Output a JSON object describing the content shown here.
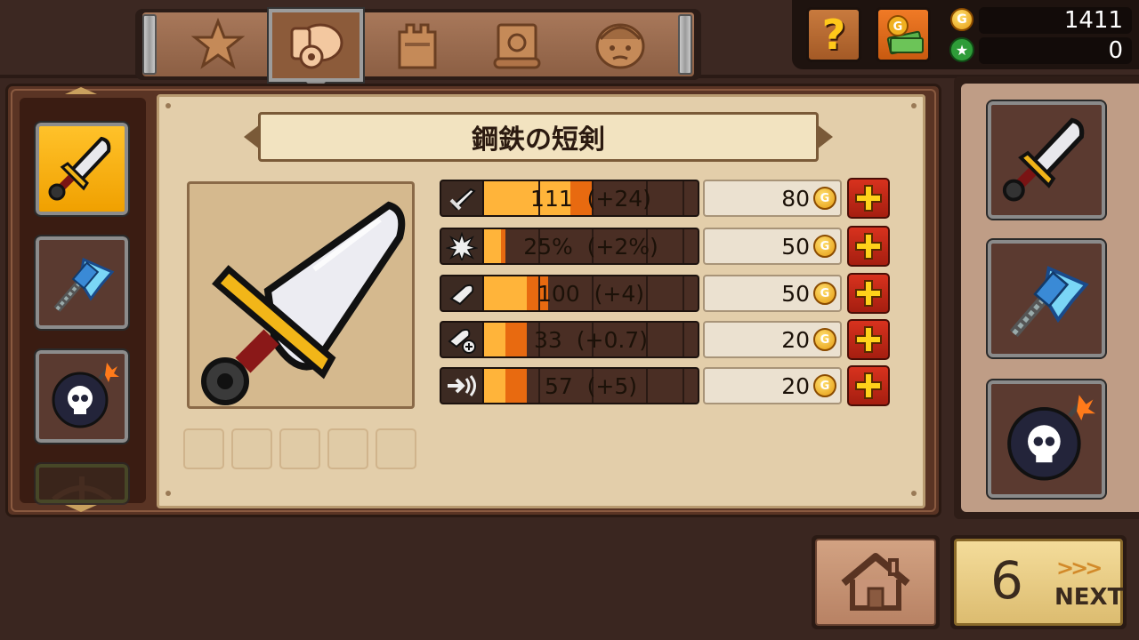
{
  "colors": {
    "accent_gold": "#ffb43a",
    "bonus_orange": "#e86a10",
    "plus_red": "#c8281a",
    "parchment": "#e3ceaa",
    "gem_green": "#2e9c38"
  },
  "tabs": [
    {
      "icon": "star-icon",
      "active": false
    },
    {
      "icon": "cannon-icon",
      "active": true
    },
    {
      "icon": "castle-tower-icon",
      "active": false
    },
    {
      "icon": "scroll-icon",
      "active": false
    },
    {
      "icon": "hero-face-icon",
      "active": false
    }
  ],
  "header": {
    "help_label": "?",
    "gold_amount": "1411",
    "gem_amount": "0",
    "gold_coin_letter": "G"
  },
  "weapon_list": [
    {
      "icon": "dagger-icon",
      "selected": true
    },
    {
      "icon": "ice-axe-icon",
      "selected": false
    },
    {
      "icon": "skull-bomb-icon",
      "selected": false
    },
    {
      "icon": "crossbow-icon",
      "selected": false,
      "locked": true
    }
  ],
  "detail": {
    "weapon_name": "鋼鉄の短剣",
    "weapon_icon": "dagger-icon",
    "empty_sockets": 5,
    "stats": [
      {
        "icon": "sword-attack-icon",
        "value": "111",
        "bonus": "(+24)",
        "base_fill": 0.4,
        "bonus_fill": 0.1,
        "cost": "80"
      },
      {
        "icon": "critical-burst-icon",
        "value": "25%",
        "bonus": "(+2%)",
        "base_fill": 0.08,
        "bonus_fill": 0.02,
        "cost": "50"
      },
      {
        "icon": "bullet-icon",
        "value": "100",
        "bonus": "(+4)",
        "base_fill": 0.2,
        "bonus_fill": 0.1,
        "cost": "50"
      },
      {
        "icon": "bullet-plus-icon",
        "value": "33",
        "bonus": "(+0.7)",
        "base_fill": 0.1,
        "bonus_fill": 0.1,
        "cost": "20"
      },
      {
        "icon": "speed-sound-icon",
        "value": "57",
        "bonus": "(+5)",
        "base_fill": 0.1,
        "bonus_fill": 0.1,
        "cost": "20"
      }
    ]
  },
  "equipped": [
    {
      "icon": "dagger-icon"
    },
    {
      "icon": "ice-axe-icon"
    },
    {
      "icon": "skull-bomb-icon"
    }
  ],
  "footer": {
    "home_icon": "home-icon",
    "stage_number": "6",
    "next_label": "NEXT",
    "next_chevrons": ">>>"
  }
}
